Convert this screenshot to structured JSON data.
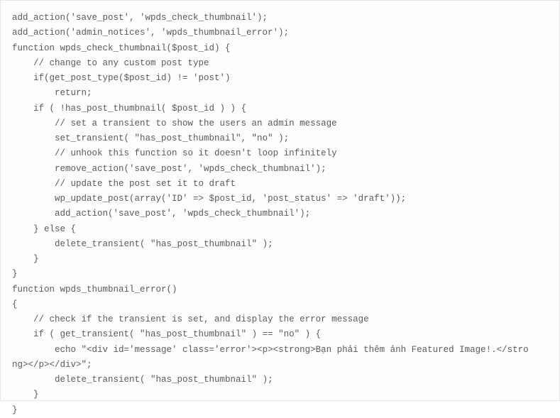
{
  "code": {
    "lines": [
      "add_action('save_post', 'wpds_check_thumbnail');",
      "add_action('admin_notices', 'wpds_thumbnail_error');",
      "function wpds_check_thumbnail($post_id) {",
      "    // change to any custom post type",
      "    if(get_post_type($post_id) != 'post')",
      "        return;",
      "    if ( !has_post_thumbnail( $post_id ) ) {",
      "        // set a transient to show the users an admin message",
      "        set_transient( \"has_post_thumbnail\", \"no\" );",
      "        // unhook this function so it doesn't loop infinitely",
      "        remove_action('save_post', 'wpds_check_thumbnail');",
      "        // update the post set it to draft",
      "        wp_update_post(array('ID' => $post_id, 'post_status' => 'draft'));",
      "        add_action('save_post', 'wpds_check_thumbnail');",
      "    } else {",
      "        delete_transient( \"has_post_thumbnail\" );",
      "    }",
      "}",
      "function wpds_thumbnail_error()",
      "{",
      "    // check if the transient is set, and display the error message",
      "    if ( get_transient( \"has_post_thumbnail\" ) == \"no\" ) {",
      "        echo \"<div id='message' class='error'><p><strong>Bạn phải thêm ảnh Featured Image!.</stro",
      "ng></p></div>\";",
      "        delete_transient( \"has_post_thumbnail\" );",
      "    }",
      "}"
    ]
  }
}
